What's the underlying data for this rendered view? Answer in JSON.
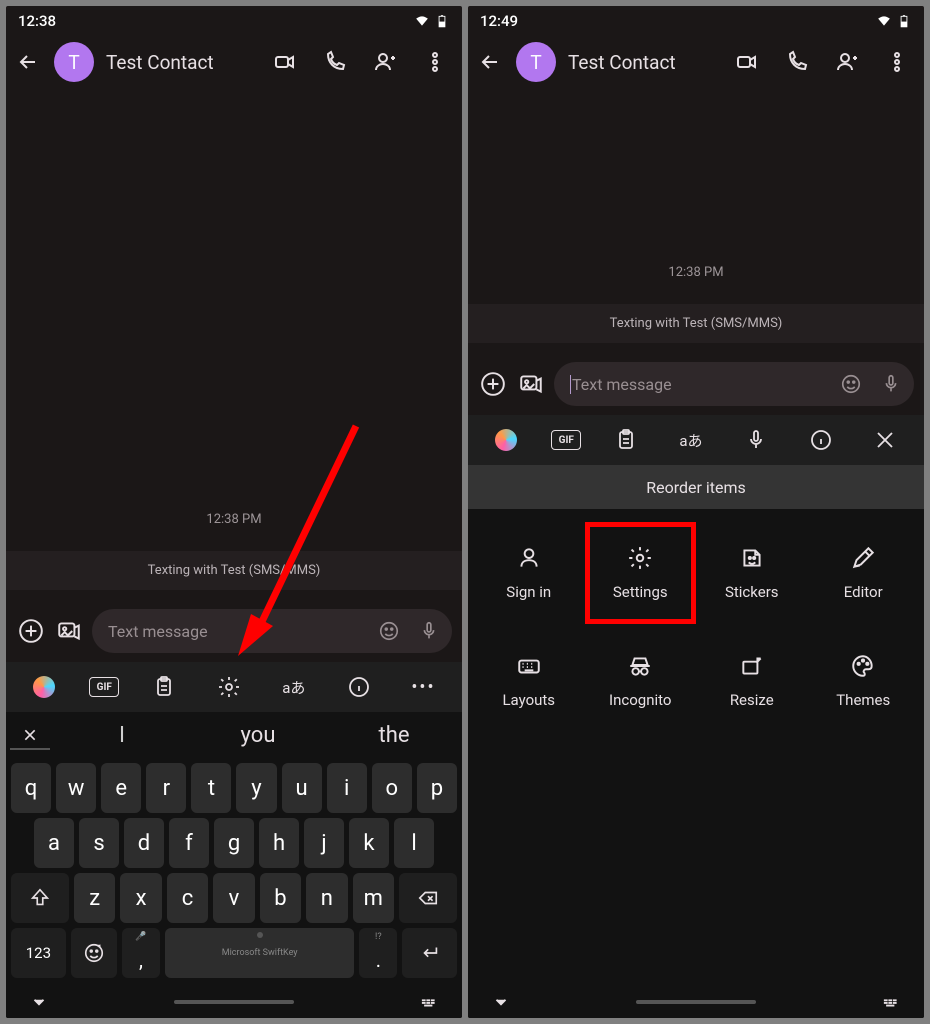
{
  "left": {
    "status_time": "12:38",
    "avatar_letter": "T",
    "contact_name": "Test Contact",
    "timestamp": "12:38 PM",
    "texting_with": "Texting with Test (SMS/MMS)",
    "input_placeholder": "Text message",
    "toolbar": {
      "gif": "GIF",
      "translate": "aあ"
    },
    "suggestions": [
      "I",
      "you",
      "the"
    ],
    "row1": [
      "q",
      "w",
      "e",
      "r",
      "t",
      "y",
      "u",
      "i",
      "o",
      "p"
    ],
    "row2": [
      "a",
      "s",
      "d",
      "f",
      "g",
      "h",
      "j",
      "k",
      "l"
    ],
    "row3": [
      "z",
      "x",
      "c",
      "v",
      "b",
      "n",
      "m"
    ],
    "numkey": "123",
    "comma": ",",
    "period": ".",
    "period_alt": "!?",
    "space_brand": "Microsoft SwiftKey"
  },
  "right": {
    "status_time": "12:49",
    "avatar_letter": "T",
    "contact_name": "Test Contact",
    "timestamp": "12:38 PM",
    "texting_with": "Texting with Test (SMS/MMS)",
    "input_placeholder": "Text message",
    "toolbar": {
      "gif": "GIF",
      "translate": "aあ"
    },
    "reorder_title": "Reorder items",
    "grid": [
      {
        "label": "Sign in"
      },
      {
        "label": "Settings",
        "highlight": true
      },
      {
        "label": "Stickers"
      },
      {
        "label": "Editor"
      },
      {
        "label": "Layouts"
      },
      {
        "label": "Incognito"
      },
      {
        "label": "Resize"
      },
      {
        "label": "Themes"
      }
    ]
  }
}
